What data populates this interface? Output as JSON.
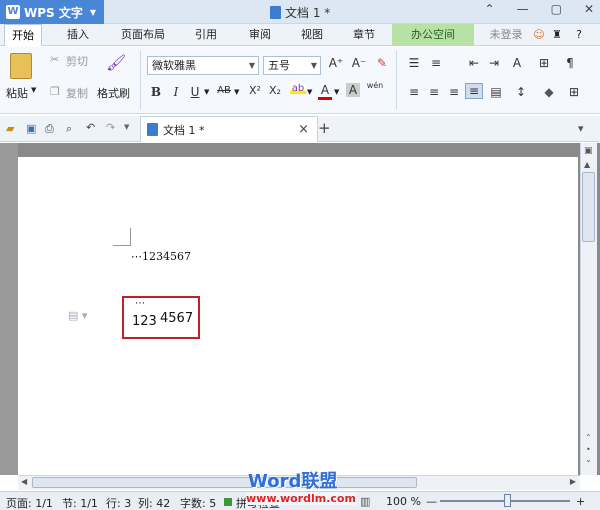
{
  "app": {
    "name": "WPS 文字",
    "logo": "W"
  },
  "window": {
    "doc_title": "文档 1 *",
    "controls": [
      "⌃",
      "—",
      "▢",
      "✕"
    ]
  },
  "menu": {
    "tabs": [
      "开始",
      "插入",
      "页面布局",
      "引用",
      "审阅",
      "视图",
      "章节",
      "办公空间"
    ],
    "account": "未登录",
    "help": "?"
  },
  "ribbon": {
    "paste": "粘贴",
    "cut": "剪切",
    "copy": "复制",
    "format_painter": "格式刷",
    "font_name": "微软雅黑",
    "font_size": "五号",
    "bold": "B",
    "italic": "I",
    "underline": "U",
    "strikethrough": "AB",
    "superscript": "X²",
    "subscript": "X₂",
    "font_color": "A",
    "char_shading": "A",
    "phonetic": "wén",
    "grow_font": "A⁺",
    "shrink_font": "A⁻"
  },
  "doc_tab": {
    "label": "文档 1 *",
    "close": "×",
    "add": "+"
  },
  "document": {
    "line1": "⋯1234567",
    "box_ellipsis": "⋯",
    "box_num1": "123",
    "box_num2": "4567"
  },
  "status": {
    "page": "页面: 1/1",
    "section": "节: 1/1",
    "row": "行: 3",
    "col": "列: 42",
    "words": "字数: 5",
    "spell": "拼写检查",
    "zoom": "100 %"
  },
  "watermark": {
    "text": "Word联盟",
    "url": "www.wordlm.com"
  },
  "colors": {
    "app_blue": "#4a86d6",
    "office_green": "#b7e2a6",
    "highlight_red": "#c0202a"
  }
}
